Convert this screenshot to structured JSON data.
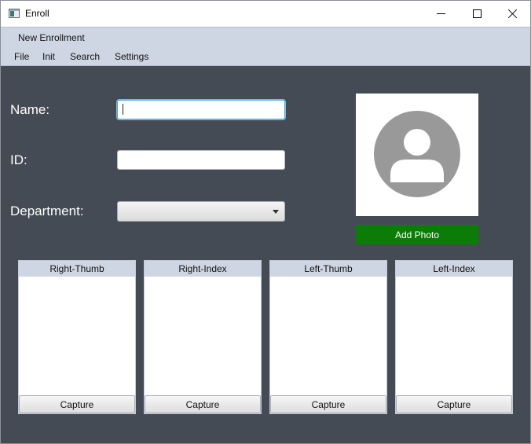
{
  "window": {
    "title": "Enroll",
    "icon": "app-icon",
    "controls": [
      "minimize-icon",
      "maximize-icon",
      "close-icon"
    ]
  },
  "tab": {
    "label": "New Enrollment"
  },
  "menu": {
    "items": [
      {
        "label": "File"
      },
      {
        "label": "Init"
      },
      {
        "label": "Search"
      },
      {
        "label": "Settings"
      }
    ]
  },
  "form": {
    "name_label": "Name:",
    "name_value": "",
    "id_label": "ID:",
    "id_value": "",
    "department_label": "Department:",
    "department_value": ""
  },
  "photo": {
    "placeholder_icon": "user-avatar-icon",
    "button_label": "Add Photo",
    "button_color": "#0b7d06"
  },
  "fingers": [
    {
      "label": "Right-Thumb",
      "button": "Capture"
    },
    {
      "label": "Right-Index",
      "button": "Capture"
    },
    {
      "label": "Left-Thumb",
      "button": "Capture"
    },
    {
      "label": "Left-Index",
      "button": "Capture"
    }
  ],
  "colors": {
    "background": "#454b54",
    "header_bar": "#cfd6e3",
    "accent_focus": "#4aa3d8"
  }
}
